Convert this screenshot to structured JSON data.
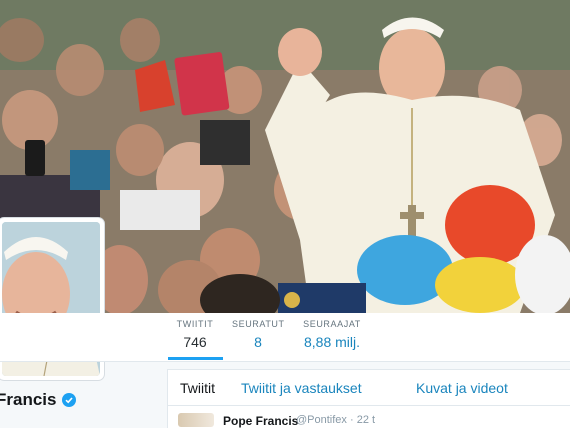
{
  "profile": {
    "name": "Francis",
    "verified": true
  },
  "stats": [
    {
      "label": "TWIITIT",
      "value": "746"
    },
    {
      "label": "SEURATUT",
      "value": "8"
    },
    {
      "label": "SEURAAJAT",
      "value": "8,88 milj."
    }
  ],
  "tabs": [
    {
      "label": "Twiitit",
      "active": true
    },
    {
      "label": "Twiitit ja vastaukset",
      "active": false
    },
    {
      "label": "Kuvat ja videot",
      "active": false
    }
  ],
  "tweet": {
    "author": "Pope Francis",
    "handle": "@Pontifex",
    "time": "· 22 t"
  },
  "colors": {
    "accent": "#1da1f2",
    "link": "#1a85bd"
  },
  "icons": {
    "verified": "verified-badge-icon"
  }
}
